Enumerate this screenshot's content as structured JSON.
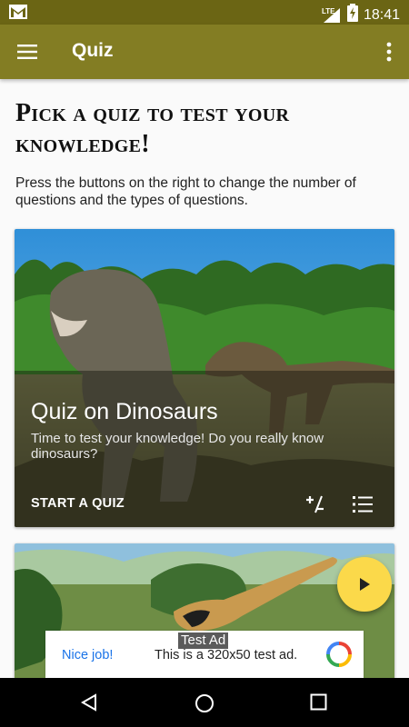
{
  "status_bar": {
    "network": "LTE",
    "time": "18:41",
    "icons": [
      "gmail-icon",
      "signal-icon",
      "battery-icon"
    ]
  },
  "app_bar": {
    "title": "Quiz",
    "icons": [
      "menu-icon",
      "more-vert-icon"
    ],
    "color": "#837d23"
  },
  "main": {
    "heading": "Pick a quiz to test your knowledge!",
    "description": "Press the buttons on the right to change the number of questions and the types of questions."
  },
  "cards": [
    {
      "title": "Quiz on Dinosaurs",
      "subtitle": "Time to test your knowledge! Do you really know dinosaurs?",
      "action_label": "START A QUIZ",
      "icons": [
        "plus-minus-icon",
        "list-icon"
      ]
    }
  ],
  "fab": {
    "icon": "play-icon",
    "color": "#fbd94a"
  },
  "ad": {
    "badge": "Test Ad",
    "cta": "Nice job!",
    "text": "This is a 320x50 test ad.",
    "icon": "ad-choices-icon"
  },
  "nav_bar": {
    "icons": [
      "back-icon",
      "home-icon",
      "recents-icon"
    ]
  }
}
